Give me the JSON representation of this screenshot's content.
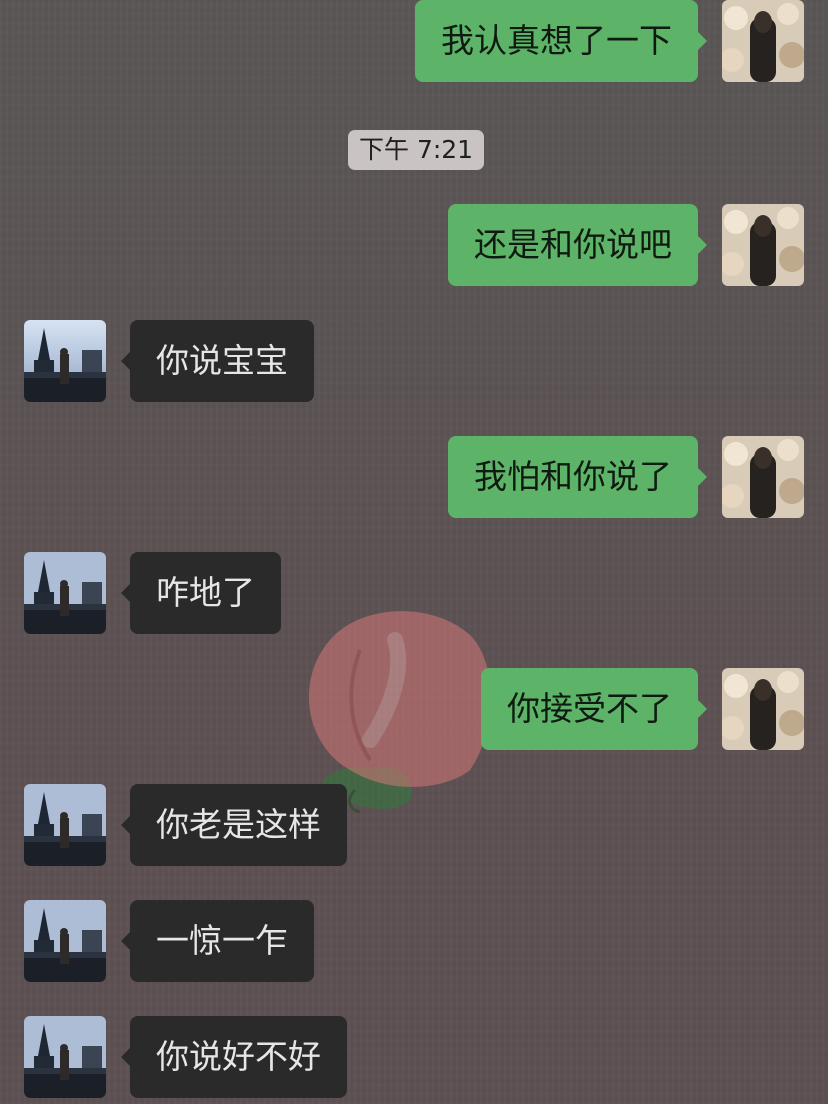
{
  "chat": {
    "timestamp": "下午 7:21",
    "messages": [
      {
        "side": "out",
        "text": "我认真想了一下"
      },
      {
        "side": "out",
        "text": "还是和你说吧"
      },
      {
        "side": "in",
        "text": "你说宝宝"
      },
      {
        "side": "out",
        "text": "我怕和你说了"
      },
      {
        "side": "in",
        "text": "咋地了"
      },
      {
        "side": "out",
        "text": "你接受不了"
      },
      {
        "side": "in",
        "text": "你老是这样"
      },
      {
        "side": "in",
        "text": "一惊一乍"
      },
      {
        "side": "in",
        "text": "你说好不好"
      }
    ]
  },
  "colors": {
    "outgoing_bubble": "#5db468",
    "incoming_bubble": "#2a2a2a",
    "background": "#5b5353",
    "timestamp_badge": "#c9c3c3"
  },
  "icons": {
    "self_avatar": "photo-avatar-woman",
    "contact_avatar": "photo-avatar-tower-scene"
  }
}
